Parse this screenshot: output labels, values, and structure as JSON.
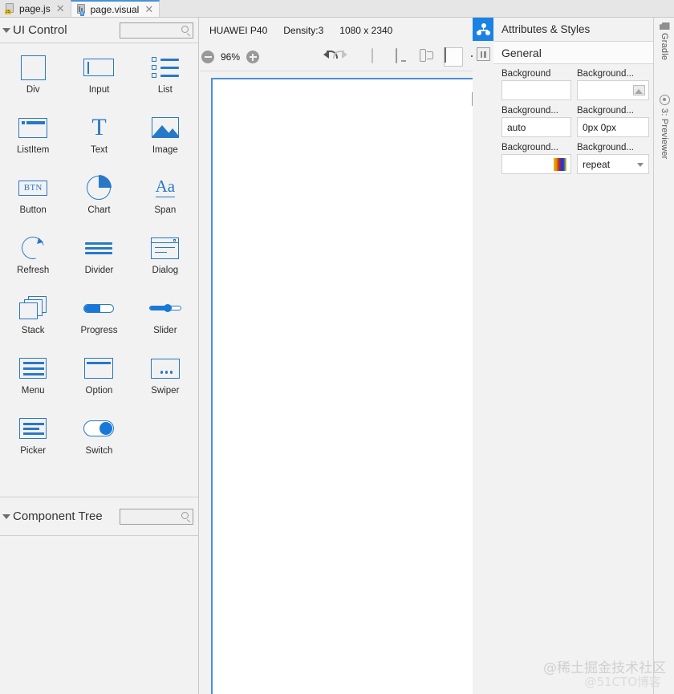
{
  "tabs": [
    {
      "label": "page.js",
      "icon": "js-file-icon",
      "active": false
    },
    {
      "label": "page.visual",
      "icon": "visual-file-icon",
      "active": true
    }
  ],
  "left_panel": {
    "ui_control": {
      "title": "UI Control",
      "search_placeholder": "",
      "search_value": ""
    },
    "components": [
      {
        "label": "Div",
        "icon": "div-icon"
      },
      {
        "label": "Input",
        "icon": "input-icon"
      },
      {
        "label": "List",
        "icon": "list-icon"
      },
      {
        "label": "ListItem",
        "icon": "listitem-icon"
      },
      {
        "label": "Text",
        "icon": "text-icon"
      },
      {
        "label": "Image",
        "icon": "image-icon"
      },
      {
        "label": "Button",
        "icon": "button-icon",
        "glyph": "BTN"
      },
      {
        "label": "Chart",
        "icon": "chart-icon"
      },
      {
        "label": "Span",
        "icon": "span-icon",
        "glyph": "Aa"
      },
      {
        "label": "Refresh",
        "icon": "refresh-icon"
      },
      {
        "label": "Divider",
        "icon": "divider-icon"
      },
      {
        "label": "Dialog",
        "icon": "dialog-icon"
      },
      {
        "label": "Stack",
        "icon": "stack-icon"
      },
      {
        "label": "Progress",
        "icon": "progress-icon"
      },
      {
        "label": "Slider",
        "icon": "slider-icon"
      },
      {
        "label": "Menu",
        "icon": "menu-icon"
      },
      {
        "label": "Option",
        "icon": "option-icon"
      },
      {
        "label": "Swiper",
        "icon": "swiper-icon"
      },
      {
        "label": "Picker",
        "icon": "picker-icon"
      },
      {
        "label": "Switch",
        "icon": "switch-icon"
      }
    ],
    "component_tree": {
      "title": "Component Tree",
      "search_placeholder": "",
      "search_value": ""
    }
  },
  "device_bar": {
    "device": "HUAWEI P40",
    "density": "Density:3",
    "resolution": "1080 x 2340"
  },
  "toolbar": {
    "zoom_out": "zoom-out",
    "zoom_level": "96%",
    "zoom_in": "zoom-in",
    "buttons": [
      {
        "name": "undo-button",
        "state": "enabled"
      },
      {
        "name": "redo-button",
        "state": "disabled"
      },
      {
        "name": "phone-preview-button",
        "state": "enabled"
      },
      {
        "name": "tablet-preview-button",
        "state": "enabled"
      },
      {
        "name": "foldable-preview-button",
        "state": "enabled"
      },
      {
        "name": "square-preview-button",
        "state": "enabled"
      },
      {
        "name": "theme-brightness-button",
        "state": "enabled"
      },
      {
        "name": "layout-direction-button",
        "state": "enabled"
      },
      {
        "name": "component-tree-toggle-button",
        "state": "selected"
      }
    ]
  },
  "canvas": {
    "pause_button": "pause-render-button"
  },
  "right_panel": {
    "title": "Attributes & Styles",
    "section": "General",
    "properties": [
      {
        "label": "Background",
        "value": "",
        "kind": "color"
      },
      {
        "label": "Background...",
        "value": "",
        "kind": "image"
      },
      {
        "label": "Background...",
        "value": "auto",
        "kind": "text"
      },
      {
        "label": "Background...",
        "value": "0px 0px",
        "kind": "text"
      },
      {
        "label": "Background...",
        "value": "",
        "kind": "gradient"
      },
      {
        "label": "Background...",
        "value": "repeat",
        "kind": "select"
      }
    ]
  },
  "rail": [
    {
      "label": "Gradle",
      "icon": "gradle-icon"
    },
    {
      "label": "3: Previewer",
      "icon": "previewer-icon"
    }
  ],
  "watermarks": {
    "primary": "@稀土掘金技术社区",
    "secondary": "@51CTO博客"
  },
  "colors": {
    "accent": "#1a82e2",
    "component_blue": "#2878c8",
    "canvas_border": "#4a90d9",
    "panel_bg": "#f2f2f2"
  }
}
